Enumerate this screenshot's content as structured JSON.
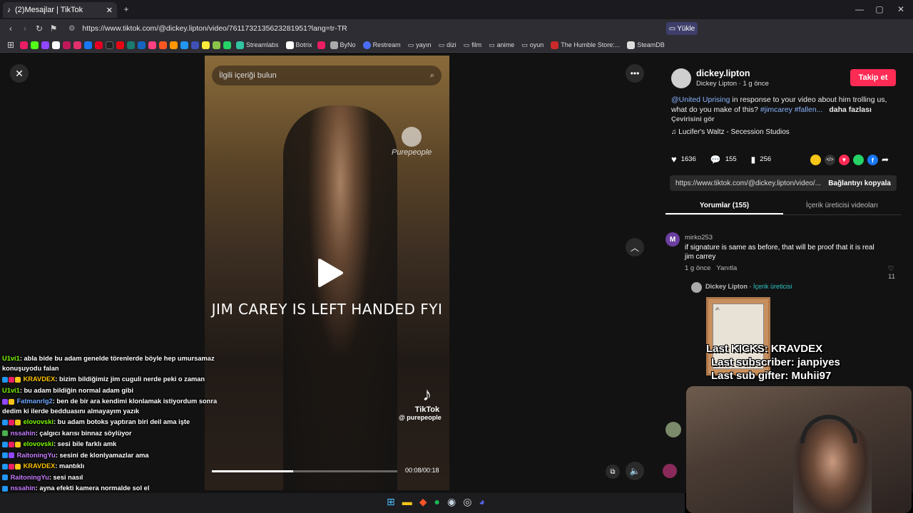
{
  "browser": {
    "tab_title": "(2)Mesajlar | TikTok",
    "url": "https://www.tiktok.com/@dickey.lipton/video/7611732135623281951?lang=tr-TR",
    "upload_label": "Yükle",
    "bookmarks": [
      "Streamlabs",
      "Botrix",
      "ByNo",
      "Restream",
      "yayın",
      "dizi",
      "film",
      "anime",
      "oyun",
      "The Humble Store:...",
      "SteamDB"
    ]
  },
  "video": {
    "search_placeholder": "İlgili içeriği bulun",
    "caption": "JIM CAREY IS LEFT HANDED FYI",
    "watermark_brand": "Purepeople",
    "tiktok_logo": "TikTok",
    "tiktok_handle": "@ purepeople",
    "time": "00:08/00:18",
    "progress": 0.44
  },
  "post": {
    "username": "dickey.lipton",
    "display_name": "Dickey Lipton",
    "age": "1 g önce",
    "follow_label": "Takip et",
    "mention": "@United Uprising",
    "description": " in response to your video about him trolling us, what do you make of this? ",
    "hashtags": "#jimcarey #fallen...",
    "more": "daha fazlası",
    "translate": "Çevirisini gör",
    "music": "Lucifer's Waltz - Secession Studios",
    "likes": "1636",
    "comments": "155",
    "saves": "256",
    "share_url": "https://www.tiktok.com/@dickey.lipton/video/...",
    "copy_label": "Bağlantıyı kopyala",
    "tab_comments": "Yorumlar (155)",
    "tab_creator": "İçerik üreticisi videoları"
  },
  "comment": {
    "avatar_letter": "M",
    "user": "mirko253",
    "text": "if signature is same as before, that will be proof that it is real jim carrey",
    "age": "1 g önce",
    "reply": "Yanıtla",
    "likes": "11",
    "reply_user": "Dickey Lipton",
    "reply_tag": "İçerik üreticisi"
  },
  "stream_overlay": {
    "last_kicks": "Last KICKS: KRAVDEX",
    "last_sub": "Last subscriber: janpiyes",
    "last_gifter": "Last sub gifter: Muhii97"
  },
  "chat": [
    {
      "user": "U1vi1",
      "color": "#7CFC00",
      "text": ": abla bide bu adam genelde törenlerde böyle hep umursamaz konuşuyodu falan"
    },
    {
      "user": "KRAVDEX",
      "color": "#FFC400",
      "text": ": bizim bildiğimiz jim cuguli nerde peki o zaman"
    },
    {
      "user": "U1vi1",
      "color": "#7CFC00",
      "text": ": bu adam bildiğin normal adam gibi"
    },
    {
      "user": "Fatmanrlg2",
      "color": "#6FA8FF",
      "text": ": ben de bir ara kendimi klonlamak istiyordum sonra dedim ki ilerde bedduasını almayayım yazık"
    },
    {
      "user": "elovovski",
      "color": "#7CFC00",
      "text": ": bu adam botoks yaptıran biri deil ama işte"
    },
    {
      "user": "nssahin",
      "color": "#C77DFF",
      "text": ": çalgıcı karısı binnaz söylüyor"
    },
    {
      "user": "elovovski",
      "color": "#7CFC00",
      "text": ": sesi bile farklı amk"
    },
    {
      "user": "RaitoningYu",
      "color": "#C77DFF",
      "text": ": sesini de klonlyamazlar ama"
    },
    {
      "user": "KRAVDEX",
      "color": "#FFC400",
      "text": ": mantıklı"
    },
    {
      "user": "RaitoningYu",
      "color": "#C77DFF",
      "text": ": sesi nasıl"
    },
    {
      "user": "nssahin",
      "color": "#C77DFF",
      "text": ": ayna efekti kamera normalde sol el"
    }
  ]
}
